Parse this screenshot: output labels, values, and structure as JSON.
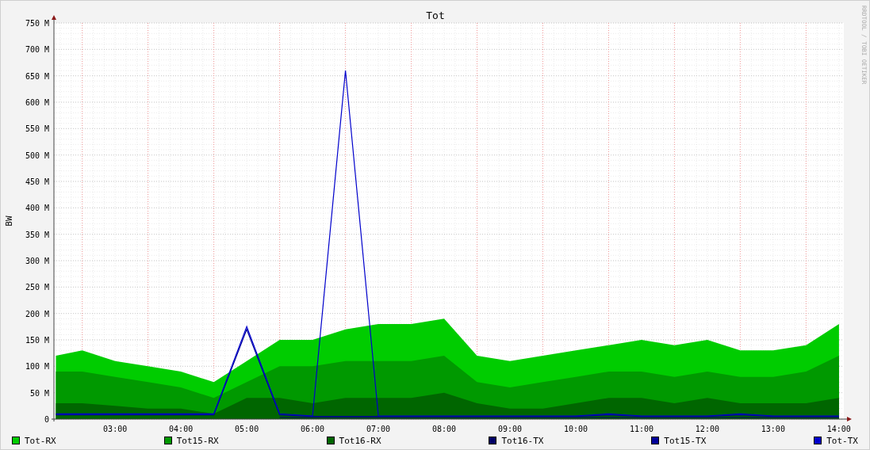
{
  "chart": {
    "chart_data": {
      "type": "area",
      "title": "Tot",
      "ylabel": "BW",
      "stacked": false,
      "x": [
        2.1,
        2.5,
        3,
        3.5,
        4,
        4.5,
        5,
        5.5,
        6,
        6.5,
        7,
        7.5,
        8,
        8.5,
        9,
        9.5,
        10,
        10.5,
        11,
        11.5,
        12,
        12.5,
        13,
        13.5,
        14
      ],
      "series": [
        {
          "name": "Tot-RX",
          "color": "#00cc00",
          "type": "area",
          "values": [
            120,
            130,
            110,
            100,
            90,
            70,
            110,
            150,
            150,
            170,
            180,
            180,
            190,
            120,
            110,
            120,
            130,
            140,
            150,
            140,
            150,
            130,
            130,
            140,
            180
          ]
        },
        {
          "name": "Tot15-RX",
          "color": "#009900",
          "type": "area",
          "values": [
            90,
            90,
            80,
            70,
            60,
            40,
            70,
            100,
            100,
            110,
            110,
            110,
            120,
            70,
            60,
            70,
            80,
            90,
            90,
            80,
            90,
            80,
            80,
            90,
            120
          ]
        },
        {
          "name": "Tot16-RX",
          "color": "#006600",
          "type": "area",
          "values": [
            30,
            30,
            25,
            20,
            20,
            10,
            40,
            40,
            30,
            40,
            40,
            40,
            50,
            30,
            20,
            20,
            30,
            40,
            40,
            30,
            40,
            30,
            30,
            30,
            40
          ]
        },
        {
          "name": "Tot16-TX",
          "color": "#000066",
          "type": "line",
          "values": [
            null,
            null,
            null,
            null,
            null,
            null,
            null,
            3,
            3,
            3,
            3,
            3,
            3,
            3,
            3,
            3,
            3,
            3,
            3,
            3,
            3,
            3,
            3,
            3,
            3
          ]
        },
        {
          "name": "Tot15-TX",
          "color": "#000099",
          "type": "line",
          "values": [
            8,
            8,
            8,
            8,
            8,
            8,
            170,
            8,
            5,
            5,
            5,
            5,
            5,
            5,
            5,
            5,
            5,
            8,
            5,
            5,
            5,
            8,
            5,
            5,
            5
          ]
        },
        {
          "name": "Tot-TX",
          "color": "#0000cc",
          "type": "line",
          "values": [
            10,
            10,
            10,
            10,
            10,
            10,
            175,
            10,
            6,
            660,
            6,
            6,
            6,
            6,
            6,
            6,
            6,
            10,
            6,
            6,
            6,
            10,
            6,
            6,
            6
          ]
        }
      ],
      "grid": true,
      "ref_lines": [
        {
          "axis": "x",
          "value": 2.5
        },
        {
          "axis": "x",
          "value": 3.5
        },
        {
          "axis": "x",
          "value": 4.5
        },
        {
          "axis": "x",
          "value": 5.5
        },
        {
          "axis": "x",
          "value": 6.5
        },
        {
          "axis": "x",
          "value": 7.5
        },
        {
          "axis": "x",
          "value": 8.5
        },
        {
          "axis": "x",
          "value": 9.5
        },
        {
          "axis": "x",
          "value": 10.5
        },
        {
          "axis": "x",
          "value": 11.5
        },
        {
          "axis": "x",
          "value": 12.5
        },
        {
          "axis": "x",
          "value": 13.5
        }
      ],
      "xlim": [
        2.07,
        14.05
      ],
      "ylim": [
        0,
        750
      ],
      "xticks": [
        {
          "value": 3,
          "label": "03:00"
        },
        {
          "value": 4,
          "label": "04:00"
        },
        {
          "value": 5,
          "label": "05:00"
        },
        {
          "value": 6,
          "label": "06:00"
        },
        {
          "value": 7,
          "label": "07:00"
        },
        {
          "value": 8,
          "label": "08:00"
        },
        {
          "value": 9,
          "label": "09:00"
        },
        {
          "value": 10,
          "label": "10:00"
        },
        {
          "value": 11,
          "label": "11:00"
        },
        {
          "value": 12,
          "label": "12:00"
        },
        {
          "value": 13,
          "label": "13:00"
        },
        {
          "value": 14,
          "label": "14:00"
        }
      ],
      "yticks": [
        {
          "value": 0,
          "label": "0"
        },
        {
          "value": 50,
          "label": "50 M"
        },
        {
          "value": 100,
          "label": "100 M"
        },
        {
          "value": 150,
          "label": "150 M"
        },
        {
          "value": 200,
          "label": "200 M"
        },
        {
          "value": 250,
          "label": "250 M"
        },
        {
          "value": 300,
          "label": "300 M"
        },
        {
          "value": 350,
          "label": "350 M"
        },
        {
          "value": 400,
          "label": "400 M"
        },
        {
          "value": 450,
          "label": "450 M"
        },
        {
          "value": 500,
          "label": "500 M"
        },
        {
          "value": 550,
          "label": "550 M"
        },
        {
          "value": 600,
          "label": "600 M"
        },
        {
          "value": 650,
          "label": "650 M"
        },
        {
          "value": 700,
          "label": "700 M"
        },
        {
          "value": 750,
          "label": "750 M"
        }
      ]
    },
    "credit": "RRDTOOL / TOBI OETIKER"
  }
}
